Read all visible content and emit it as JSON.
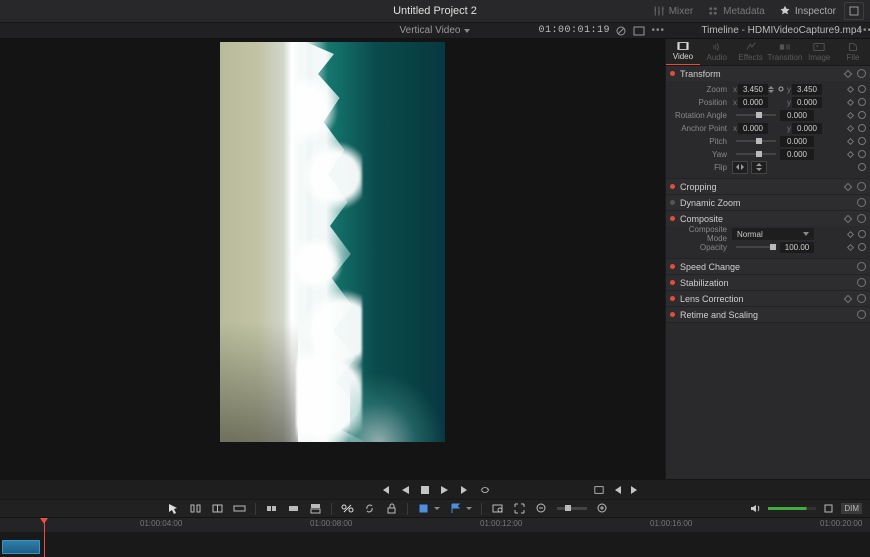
{
  "project_title": "Untitled Project 2",
  "top_tabs": {
    "mixer": "Mixer",
    "metadata": "Metadata",
    "inspector": "Inspector"
  },
  "viewer": {
    "mode": "Vertical Video",
    "timecode": "01:00:01:19"
  },
  "timeline_name": "Timeline - HDMIVideoCapture9.mp4",
  "inspector_tabs": {
    "video": "Video",
    "audio": "Audio",
    "effects": "Effects",
    "transition": "Transition",
    "image": "Image",
    "file": "File"
  },
  "sections": {
    "transform": {
      "title": "Transform",
      "zoom": {
        "label": "Zoom",
        "x": "3.450",
        "y": "3.450"
      },
      "position": {
        "label": "Position",
        "x": "0.000",
        "y": "0.000"
      },
      "rotation": {
        "label": "Rotation Angle",
        "value": "0.000"
      },
      "anchor": {
        "label": "Anchor Point",
        "x": "0.000",
        "y": "0.000"
      },
      "pitch": {
        "label": "Pitch",
        "value": "0.000"
      },
      "yaw": {
        "label": "Yaw",
        "value": "0.000"
      },
      "flip": {
        "label": "Flip"
      }
    },
    "cropping": {
      "title": "Cropping"
    },
    "dynamic_zoom": {
      "title": "Dynamic Zoom"
    },
    "composite": {
      "title": "Composite",
      "mode_label": "Composite Mode",
      "mode_value": "Normal",
      "opacity_label": "Opacity",
      "opacity_value": "100.00"
    },
    "speed": {
      "title": "Speed Change"
    },
    "stabilization": {
      "title": "Stabilization"
    },
    "lens": {
      "title": "Lens Correction"
    },
    "retime": {
      "title": "Retime and Scaling"
    }
  },
  "axis": {
    "x": "x",
    "y": "y"
  },
  "ruler": {
    "t0": "01:00:04:00",
    "t1": "01:00:08:00",
    "t2": "01:00:12:00",
    "t3": "01:00:16:00",
    "t4": "01:00:20:00"
  },
  "toolstrip": {
    "dim": "DIM"
  }
}
